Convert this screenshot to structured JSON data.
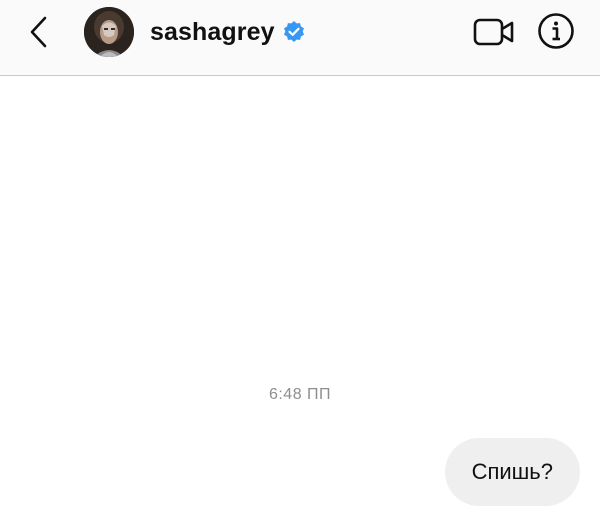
{
  "header": {
    "username": "sashagrey",
    "verified": true,
    "back_icon": "chevron-left-icon",
    "video_icon": "video-camera-icon",
    "info_icon": "info-icon",
    "verified_color": "#3897f0"
  },
  "conversation": {
    "timestamp": "6:48 ПП",
    "messages": [
      {
        "from": "me",
        "text": "Спишь?"
      }
    ]
  }
}
